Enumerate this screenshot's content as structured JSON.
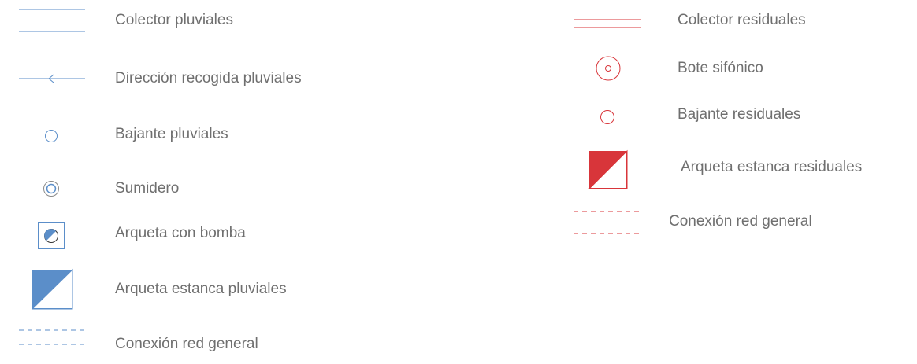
{
  "colors": {
    "pluviales": "#5b8ec9",
    "residuales": "#d8353a",
    "text": "#6f6f6f"
  },
  "legend": {
    "pluviales": [
      {
        "symbol": "double-line-icon",
        "label": "Colector pluviales"
      },
      {
        "symbol": "arrow-line-icon",
        "label": "Dirección recogida pluviales"
      },
      {
        "symbol": "circle-icon",
        "label": "Bajante pluviales"
      },
      {
        "symbol": "double-circle-icon",
        "label": "Sumidero"
      },
      {
        "symbol": "box-pump-icon",
        "label": "Arqueta con bomba"
      },
      {
        "symbol": "half-filled-square-icon",
        "label": "Arqueta estanca pluviales"
      },
      {
        "symbol": "dashed-double-line-icon",
        "label": "Conexión red general"
      }
    ],
    "residuales": [
      {
        "symbol": "double-line-icon",
        "label": "Colector residuales"
      },
      {
        "symbol": "dot-circle-icon",
        "label": "Bote sifónico"
      },
      {
        "symbol": "circle-icon",
        "label": "Bajante residuales"
      },
      {
        "symbol": "half-filled-square-icon",
        "label": "Arqueta estanca residuales"
      },
      {
        "symbol": "dashed-double-line-icon",
        "label": "Conexión red general"
      }
    ]
  }
}
